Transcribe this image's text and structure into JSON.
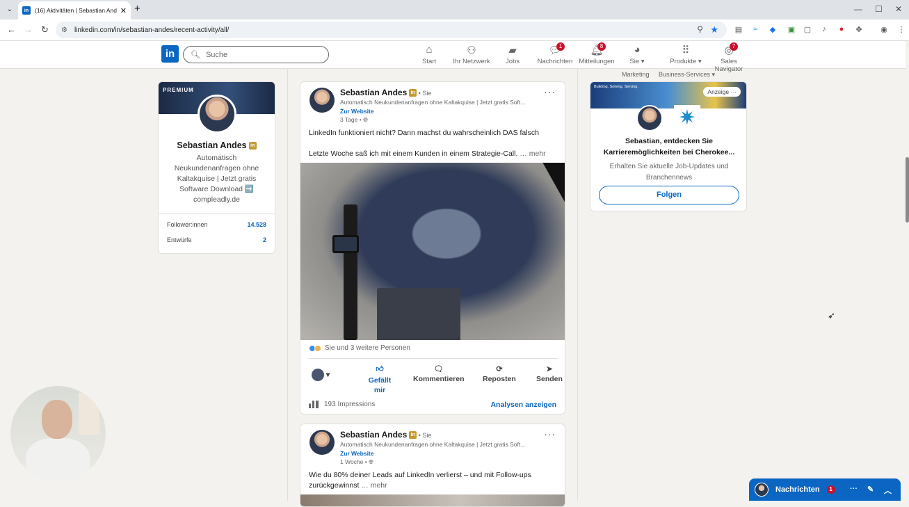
{
  "browser": {
    "tab_title": "(16) Aktivitäten | Sebastian And",
    "url": "linkedin.com/in/sebastian-andes/recent-activity/all/"
  },
  "header": {
    "search_placeholder": "Suche",
    "nav": {
      "start": "Start",
      "network": "Ihr Netzwerk",
      "jobs": "Jobs",
      "messages": "Nachrichten",
      "messages_badge": "1",
      "notifications": "Mitteilungen",
      "notifications_badge": "8",
      "me": "Sie",
      "products": "Produkte",
      "sales_navigator": "Sales Navigator",
      "sales_badge": "7"
    },
    "subnav": {
      "marketing": "Marketing",
      "business": "Business-Services"
    }
  },
  "profile": {
    "banner_label": "PREMIUM",
    "name": "Sebastian Andes",
    "in_badge": "in",
    "headline": "Automatisch Neukundenanfragen ohne Kaltakquise | Jetzt gratis Software Download ➡️ compleadly.de",
    "followers_label": "Follower:innen",
    "followers_value": "14.528",
    "drafts_label": "Entwürfe",
    "drafts_value": "2"
  },
  "posts": [
    {
      "author": "Sebastian Andes",
      "you": " • Sie",
      "headline": "Automatisch Neukundenanfragen ohne Kaltakquise | Jetzt gratis Soft...",
      "website": "Zur Website",
      "time": "3 Tage •",
      "line1": "LinkedIn funktioniert nicht? Dann machst du wahrscheinlich DAS falsch",
      "line2": "Letzte Woche saß ich mit einem Kunden in einem Strategie-Call.",
      "more": " … mehr",
      "reactions": "Sie und 3 weitere Personen",
      "like": "Gefällt mir",
      "comment": "Kommentieren",
      "repost": "Reposten",
      "send": "Senden",
      "impressions": "193 Impressions",
      "analytics": "Analysen anzeigen"
    },
    {
      "author": "Sebastian Andes",
      "you": " • Sie",
      "headline": "Automatisch Neukundenanfragen ohne Kaltakquise | Jetzt gratis Soft...",
      "website": "Zur Website",
      "time": "1 Woche •",
      "line1": "Wie du 80% deiner Leads auf LinkedIn verlierst – und mit Follow-ups",
      "line2": "zurückgewinnst",
      "more": " … mehr"
    }
  ],
  "ad": {
    "slogan": "Building. Solving. Serving.",
    "label": "Anzeige",
    "headline_1": "Sebastian, entdecken Sie",
    "headline_2": "Karrieremöglichkeiten bei Cherokee...",
    "sub_1": "Erhalten Sie aktuelle Job-Updates und",
    "sub_2": "Branchennews",
    "follow": "Folgen"
  },
  "messaging": {
    "label": "Nachrichten",
    "badge": "1"
  }
}
